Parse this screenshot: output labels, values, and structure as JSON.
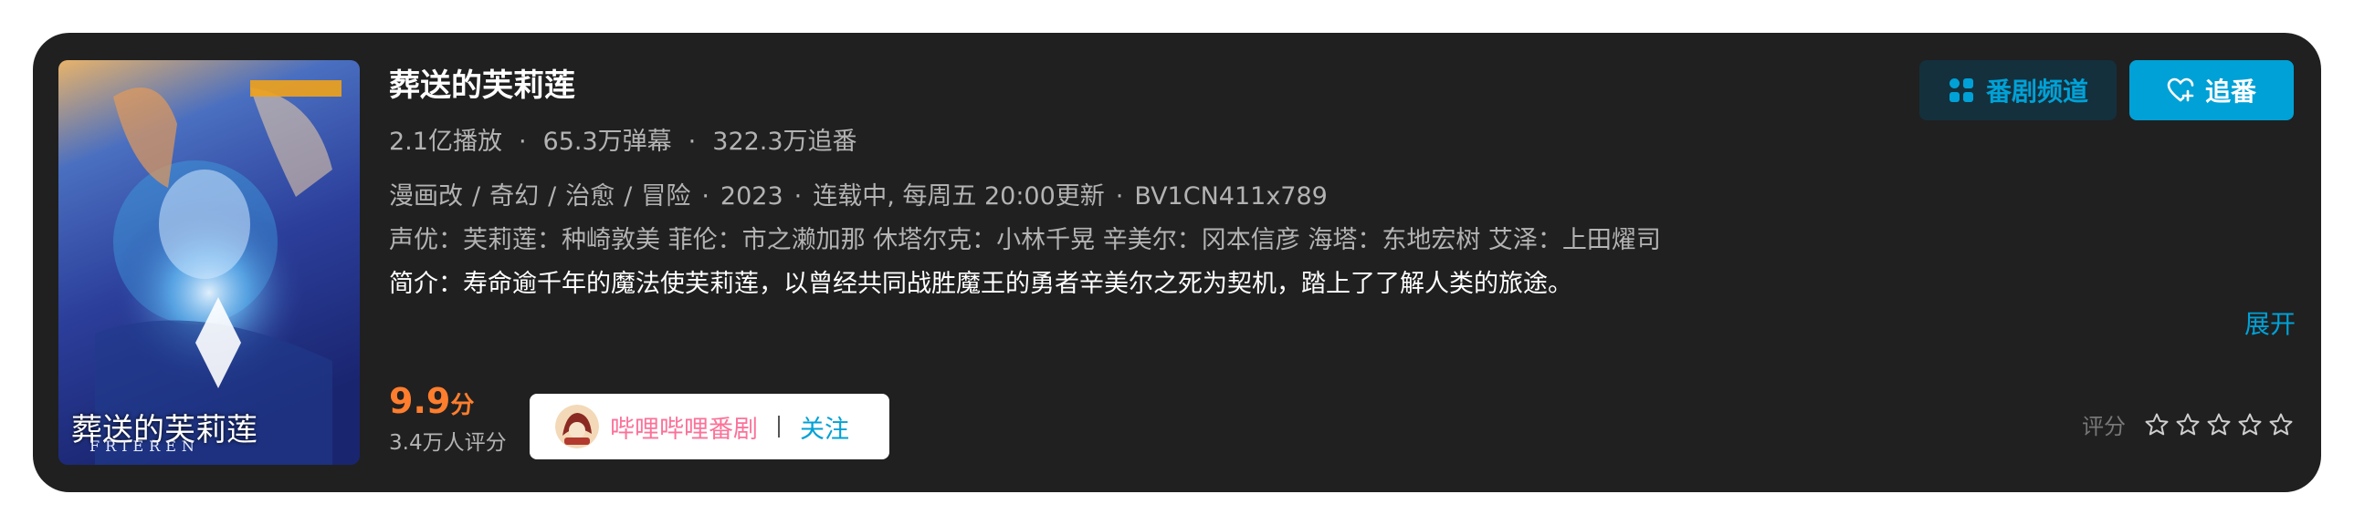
{
  "title": "葬送的芙莉莲",
  "stats": [
    "2.1亿播放",
    "65.3万弹幕",
    "322.3万追番"
  ],
  "stats_sep": "·",
  "tags": [
    "漫画改",
    "奇幻",
    "治愈",
    "冒险"
  ],
  "tag_sep": "/",
  "meta_sep": "·",
  "year": "2023",
  "status": "连载中, 每周五 20:00更新",
  "bvid": "BV1CN411x789",
  "cast": "声优：芙莉莲：种崎敦美 菲伦：市之濑加那 休塔尔克：小林千晃 辛美尔：冈本信彦 海塔：东地宏树 艾泽：上田燿司",
  "intro": "简介：寿命逾千年的魔法使芙莉莲，以曾经共同战胜魔王的勇者辛美尔之死为契机，踏上了了解人类的旅途。",
  "expand_label": "展开",
  "buttons": {
    "channel_label": "番剧频道",
    "follow_label": "追番"
  },
  "score": {
    "value": "9.9",
    "unit": "分",
    "count": "3.4万人评分"
  },
  "uploader": {
    "name": "哔哩哔哩番剧",
    "divider": "|",
    "follow_label": "关注"
  },
  "rating": {
    "label": "评分",
    "stars": 5,
    "filled": 0
  },
  "poster": {
    "title_text": "葬送的芙莉莲",
    "subtitle_text": "FRIEREN"
  },
  "colors": {
    "accent": "#00a1d6",
    "score": "#ff7e2e",
    "uploader": "#fb7299",
    "card_bg": "#202020"
  },
  "icons": {
    "channel": "grid-icon",
    "follow": "heart-plus-icon",
    "star": "star-outline-icon"
  }
}
